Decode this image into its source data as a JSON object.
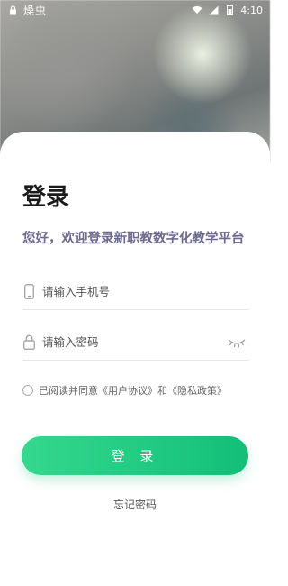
{
  "status_bar": {
    "app_name": "燥虫",
    "time": "4:10"
  },
  "login": {
    "title": "登录",
    "subtitle": "您好，欢迎登录新职教数字化教学平台",
    "phone_placeholder": "请输入手机号",
    "password_placeholder": "请输入密码",
    "agreement": {
      "prefix": "已阅读并同意",
      "user_agreement": "《用户协议》",
      "and": "和",
      "privacy_policy": "《隐私政策》"
    },
    "login_button": "登 录",
    "forgot_password": "忘记密码"
  },
  "icons": {
    "phone": "phone-icon",
    "lock": "lock-icon",
    "eye": "eye-closed-icon",
    "wifi": "wifi-icon",
    "signal": "signal-icon",
    "battery": "battery-icon"
  },
  "colors": {
    "accent": "#1ec982",
    "subtitle": "#6e6a8e"
  }
}
